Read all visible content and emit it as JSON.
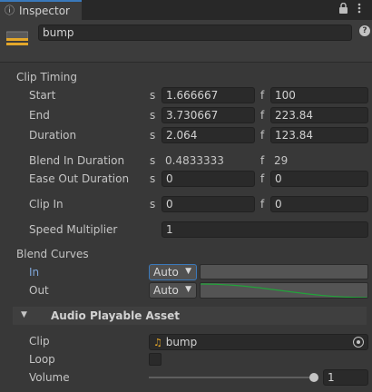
{
  "tab": {
    "title": "Inspector",
    "icon": "info-icon"
  },
  "tab_actions": {
    "lock_icon": "lock-icon",
    "menu_icon": "kebab-menu-icon"
  },
  "header": {
    "asset_icon": "timeline-clip-icon",
    "name": "bump",
    "help_icon": "?"
  },
  "clip_timing": {
    "section_label": "Clip Timing",
    "unit_s": "s",
    "unit_f": "f",
    "start": {
      "label": "Start",
      "seconds": "1.666667",
      "frames": "100"
    },
    "end": {
      "label": "End",
      "seconds": "3.730667",
      "frames": "223.84"
    },
    "duration": {
      "label": "Duration",
      "seconds": "2.064",
      "frames": "123.84"
    },
    "blend_in_duration": {
      "label": "Blend In Duration",
      "seconds": "0.4833333",
      "frames": "29"
    },
    "ease_out_duration": {
      "label": "Ease Out Duration",
      "seconds": "0",
      "frames": "0"
    },
    "clip_in": {
      "label": "Clip In",
      "seconds": "0",
      "frames": "0"
    },
    "speed_multiplier": {
      "label": "Speed Multiplier",
      "value": "1"
    }
  },
  "blend_curves": {
    "section_label": "Blend Curves",
    "in": {
      "label": "In",
      "mode": "Auto"
    },
    "out": {
      "label": "Out",
      "mode": "Auto"
    },
    "curve_color": "#22a33a"
  },
  "audio_playable_asset": {
    "section_label": "Audio Playable Asset",
    "clip": {
      "label": "Clip",
      "value": "bump",
      "icon": "audio-clip-icon"
    },
    "loop": {
      "label": "Loop",
      "checked": false
    },
    "volume": {
      "label": "Volume",
      "value": "1",
      "fraction": 1.0
    }
  },
  "colors": {
    "accent": "#3a79bb",
    "in_label": "#7fa6d8",
    "background": "#383838"
  }
}
